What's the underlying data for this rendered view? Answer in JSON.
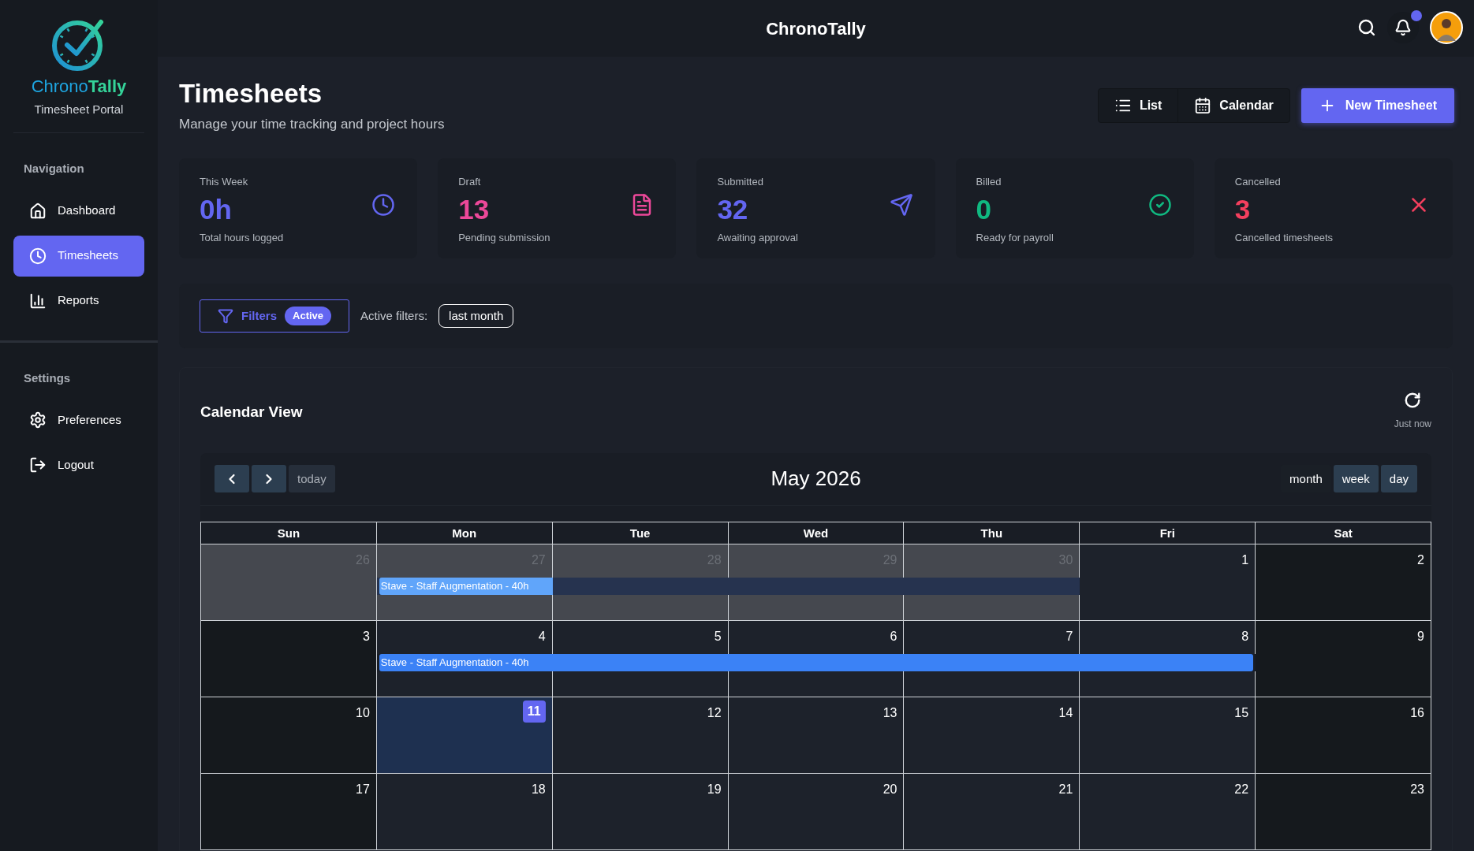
{
  "brand": {
    "name_first": "Chrono",
    "name_second": "Tally",
    "subtitle": "Timesheet Portal"
  },
  "sidebar": {
    "sections": [
      {
        "title": "Navigation",
        "items": [
          {
            "label": "Dashboard",
            "selected": false
          },
          {
            "label": "Timesheets",
            "selected": true
          },
          {
            "label": "Reports",
            "selected": false
          }
        ]
      },
      {
        "title": "Settings",
        "items": [
          {
            "label": "Preferences",
            "selected": false
          },
          {
            "label": "Logout",
            "selected": false
          }
        ]
      }
    ]
  },
  "topbar": {
    "title": "ChronoTally",
    "notification_dot": true
  },
  "page": {
    "title": "Timesheets",
    "subtitle": "Manage your time tracking and project hours"
  },
  "view_toggle": [
    {
      "label": "List"
    },
    {
      "label": "Calendar"
    }
  ],
  "new_button": "New Timesheet",
  "stats": [
    {
      "label": "This Week",
      "value": "0h",
      "caption": "Total hours logged",
      "color": "#6366f1"
    },
    {
      "label": "Draft",
      "value": "13",
      "caption": "Pending submission",
      "color": "#ec4899"
    },
    {
      "label": "Submitted",
      "value": "32",
      "caption": "Awaiting approval",
      "color": "#6366f1"
    },
    {
      "label": "Billed",
      "value": "0",
      "caption": "Ready for payroll",
      "color": "#10b981"
    },
    {
      "label": "Cancelled",
      "value": "3",
      "caption": "Cancelled timesheets",
      "color": "#f43f5e"
    }
  ],
  "filters": {
    "button": "Filters",
    "badge": "Active",
    "active_label": "Active filters:",
    "chips": [
      "last month"
    ]
  },
  "calendar": {
    "title": "Calendar View",
    "refreshed": "Just now",
    "today_button": "today",
    "month_title": "May 2026",
    "views": [
      {
        "label": "month",
        "selected": true
      },
      {
        "label": "week",
        "selected": false
      },
      {
        "label": "day",
        "selected": false
      }
    ],
    "weekdays": [
      "Sun",
      "Mon",
      "Tue",
      "Wed",
      "Thu",
      "Fri",
      "Sat"
    ],
    "weeks": [
      {
        "days": [
          {
            "n": "26",
            "kind": "other",
            "in_event": false
          },
          {
            "n": "27",
            "kind": "other",
            "in_event": true
          },
          {
            "n": "28",
            "kind": "other",
            "in_event": true
          },
          {
            "n": "29",
            "kind": "other",
            "in_event": true
          },
          {
            "n": "30",
            "kind": "other",
            "in_event": true
          },
          {
            "n": "1",
            "kind": "weekday",
            "in_event": false
          },
          {
            "n": "2",
            "kind": "weekend",
            "in_event": false
          }
        ],
        "event": {
          "title": "Stave - Staff Augmentation - 40h",
          "kind": "faded"
        }
      },
      {
        "days": [
          {
            "n": "3",
            "kind": "weekend",
            "in_event": false
          },
          {
            "n": "4",
            "kind": "weekday",
            "in_event": true
          },
          {
            "n": "5",
            "kind": "weekday",
            "in_event": true
          },
          {
            "n": "6",
            "kind": "weekday",
            "in_event": true
          },
          {
            "n": "7",
            "kind": "weekday",
            "in_event": true
          },
          {
            "n": "8",
            "kind": "weekday",
            "in_event": true
          },
          {
            "n": "9",
            "kind": "weekend",
            "in_event": false
          }
        ],
        "event": {
          "title": "Stave - Staff Augmentation - 40h",
          "kind": "solid"
        }
      },
      {
        "days": [
          {
            "n": "10",
            "kind": "weekend",
            "in_event": false
          },
          {
            "n": "11",
            "kind": "today",
            "in_event": false
          },
          {
            "n": "12",
            "kind": "weekday",
            "in_event": false
          },
          {
            "n": "13",
            "kind": "weekday",
            "in_event": false
          },
          {
            "n": "14",
            "kind": "weekday",
            "in_event": false
          },
          {
            "n": "15",
            "kind": "weekday",
            "in_event": false
          },
          {
            "n": "16",
            "kind": "weekend",
            "in_event": false
          }
        ]
      },
      {
        "days": [
          {
            "n": "17",
            "kind": "weekend",
            "in_event": false
          },
          {
            "n": "18",
            "kind": "weekday",
            "in_event": false
          },
          {
            "n": "19",
            "kind": "weekday",
            "in_event": false
          },
          {
            "n": "20",
            "kind": "weekday",
            "in_event": false
          },
          {
            "n": "21",
            "kind": "weekday",
            "in_event": false
          },
          {
            "n": "22",
            "kind": "weekday",
            "in_event": false
          },
          {
            "n": "23",
            "kind": "weekend",
            "in_event": false
          }
        ]
      }
    ]
  }
}
